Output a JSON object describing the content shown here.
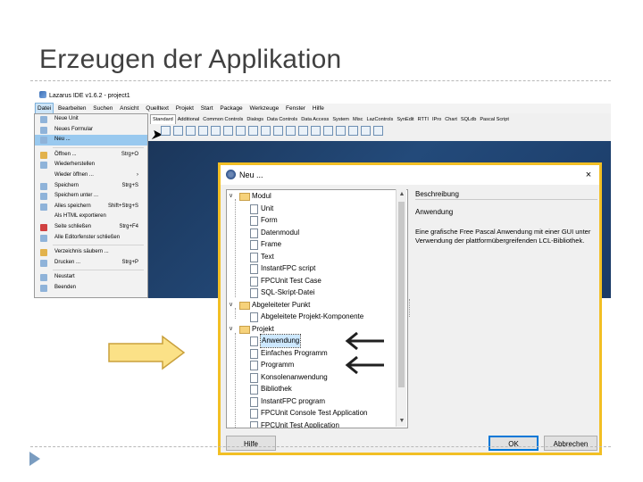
{
  "slide": {
    "title": "Erzeugen der Applikation"
  },
  "ide": {
    "title": "Lazarus IDE v1.6.2 - project1",
    "menubar": [
      "Datei",
      "Bearbeiten",
      "Suchen",
      "Ansicht",
      "Quelltext",
      "Projekt",
      "Start",
      "Package",
      "Werkzeuge",
      "Fenster",
      "Hilfe"
    ],
    "palette_tabs": [
      "Standard",
      "Additional",
      "Common Controls",
      "Dialogs",
      "Data Controls",
      "Data Access",
      "System",
      "Misc",
      "LazControls",
      "SynEdit",
      "RTTI",
      "IPro",
      "Chart",
      "SQLdb",
      "Pascal Script"
    ],
    "file_menu": [
      {
        "label": "Neue Unit",
        "shortcut": ""
      },
      {
        "label": "Neues Formular",
        "shortcut": ""
      },
      {
        "label": "Neu ...",
        "shortcut": ""
      },
      {
        "label": "Öffnen ...",
        "shortcut": "Strg+O"
      },
      {
        "label": "Wiederherstellen",
        "shortcut": ""
      },
      {
        "label": "Wieder öffnen ...",
        "shortcut": "›"
      },
      {
        "label": "Speichern",
        "shortcut": "Strg+S"
      },
      {
        "label": "Speichern unter ...",
        "shortcut": ""
      },
      {
        "label": "Alles speichern",
        "shortcut": "Shift+Strg+S"
      },
      {
        "label": "Als HTML exportieren",
        "shortcut": ""
      },
      {
        "label": "Seite schließen",
        "shortcut": "Strg+F4"
      },
      {
        "label": "Alle Editorfenster schließen",
        "shortcut": ""
      },
      {
        "label": "Verzeichnis säubern ...",
        "shortcut": ""
      },
      {
        "label": "Drucken ...",
        "shortcut": "Strg+P"
      },
      {
        "label": "Neustart",
        "shortcut": ""
      },
      {
        "label": "Beenden",
        "shortcut": ""
      }
    ]
  },
  "dialog": {
    "title": "Neu ...",
    "close": "×",
    "tree": {
      "modul": "Modul",
      "modul_items": [
        "Unit",
        "Form",
        "Datenmodul",
        "Frame",
        "Text",
        "InstantFPC script",
        "FPCUnit Test Case",
        "SQL-Skript-Datei"
      ],
      "abgeleitet": "Abgeleiteter Punkt",
      "abgeleitet_items": [
        "Abgeleitete Projekt-Komponente"
      ],
      "projekt": "Projekt",
      "projekt_items": [
        "Anwendung",
        "Einfaches Programm",
        "Programm",
        "Konsolenanwendung",
        "Bibliothek",
        "InstantFPC program",
        "FPCUnit Console Test Application",
        "FPCUnit Test Application"
      ]
    },
    "description_header": "Beschreibung",
    "description_name": "Anwendung",
    "description_text": "Eine grafische Free Pascal Anwendung mit einer GUI unter Verwendung der plattformübergreifenden LCL-Bibliothek.",
    "buttons": {
      "help": "Hilfe",
      "ok": "OK",
      "cancel": "Abbrechen"
    }
  },
  "colors": {
    "highlight_frame": "#f2bf24",
    "arrow_fill": "#fbe187",
    "menu_selected": "#99c9ef"
  }
}
